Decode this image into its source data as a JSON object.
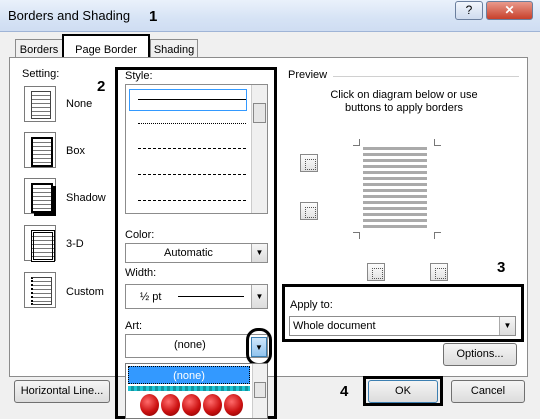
{
  "window": {
    "title": "Borders and Shading",
    "help_glyph": "?",
    "close_glyph": "✕"
  },
  "tabs": [
    {
      "label": "Borders"
    },
    {
      "label": "Page Border"
    },
    {
      "label": "Shading"
    }
  ],
  "setting": {
    "label": "Setting:",
    "options": [
      {
        "label": "None"
      },
      {
        "label": "Box"
      },
      {
        "label": "Shadow"
      },
      {
        "label": "3-D"
      },
      {
        "label": "Custom"
      }
    ]
  },
  "style": {
    "label": "Style:"
  },
  "color": {
    "label": "Color:",
    "value": "Automatic"
  },
  "width": {
    "label": "Width:",
    "value": "½ pt"
  },
  "art": {
    "label": "Art:",
    "value": "(none)",
    "dropdown_selected": "(none)"
  },
  "preview": {
    "label": "Preview",
    "hint": "Click on diagram below or use buttons to apply borders"
  },
  "apply_to": {
    "label": "Apply to:",
    "value": "Whole document"
  },
  "buttons": {
    "options": "Options...",
    "horizontal_line": "Horizontal Line...",
    "ok": "OK",
    "cancel": "Cancel"
  },
  "callouts": {
    "c1": "1",
    "c2": "2",
    "c3": "3",
    "c4": "4"
  },
  "colors": {
    "highlight": "#3399ff",
    "art_red": "#cc1111",
    "title_bg": "#d6e3f5"
  }
}
